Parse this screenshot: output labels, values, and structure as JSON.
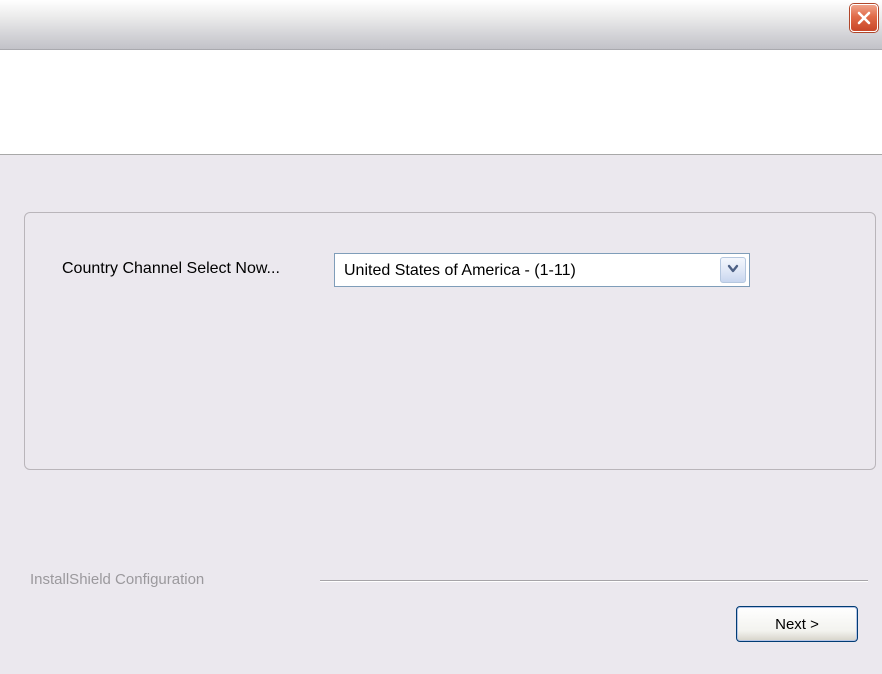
{
  "titlebar": {
    "close_icon": "close-icon"
  },
  "main": {
    "country_label": "Country Channel Select Now...",
    "country_select": {
      "value": "United States of America - (1-11)",
      "icon": "chevron-down-icon"
    }
  },
  "footer": {
    "brand": "InstallShield Configuration",
    "next_label": "Next >"
  },
  "colors": {
    "close_button": "#e06a48",
    "dialog_background": "#ebe8ee",
    "header_band": "#ffffff",
    "button_border": "#003c74"
  }
}
